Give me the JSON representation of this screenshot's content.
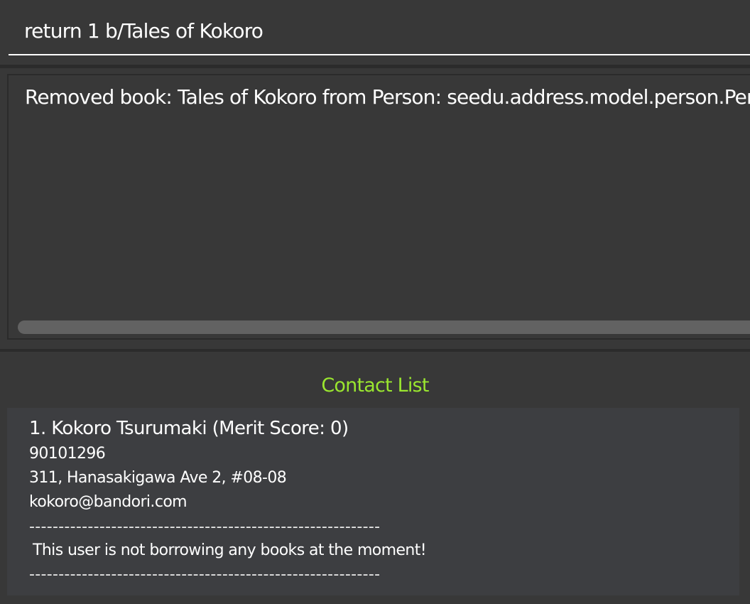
{
  "command_box": {
    "value": "return 1 b/Tales of Kokoro"
  },
  "result_display": {
    "text": "Removed book: Tales of Kokoro from Person: seedu.address.model.person.Person"
  },
  "contact_list": {
    "title": "Contact List",
    "title_color": "#9ae62f",
    "persons": [
      {
        "index_name": "1.  Kokoro Tsurumaki  (Merit Score: 0)",
        "phone": "90101296",
        "address": "311, Hanasakigawa Ave 2, #08-08",
        "email": "kokoro@bandori.com",
        "separator": "------------------------------------------------------------",
        "books_status": " This user is not borrowing any books at the moment!"
      }
    ]
  },
  "colors": {
    "background": "#383838",
    "card_background": "#3d3e41",
    "divider": "#2b2b2b",
    "scrollbar": "#626262",
    "text": "#ffffff"
  }
}
